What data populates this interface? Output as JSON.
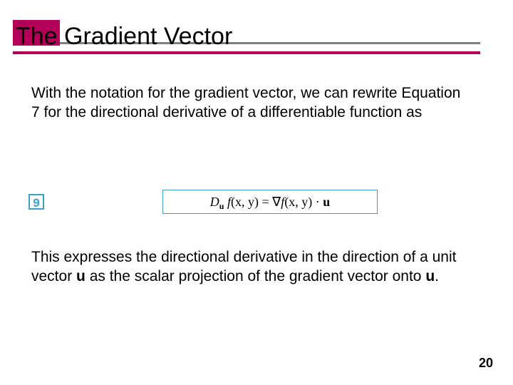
{
  "title": "The Gradient Vector",
  "para1": "With the notation for the gradient vector, we can rewrite Equation 7 for the directional derivative of a differentiable function as",
  "equation": {
    "number": "9",
    "D": "D",
    "sub": "u",
    "f": "f",
    "args": "(x, y)",
    "eq": " = ",
    "nabla": "∇",
    "dot": " · ",
    "u": "u"
  },
  "para2_a": "This expresses the directional derivative in the direction of a unit vector ",
  "para2_u1": "u",
  "para2_b": " as the scalar projection of the gradient vector onto ",
  "para2_u2": "u",
  "para2_c": ".",
  "page": "20"
}
